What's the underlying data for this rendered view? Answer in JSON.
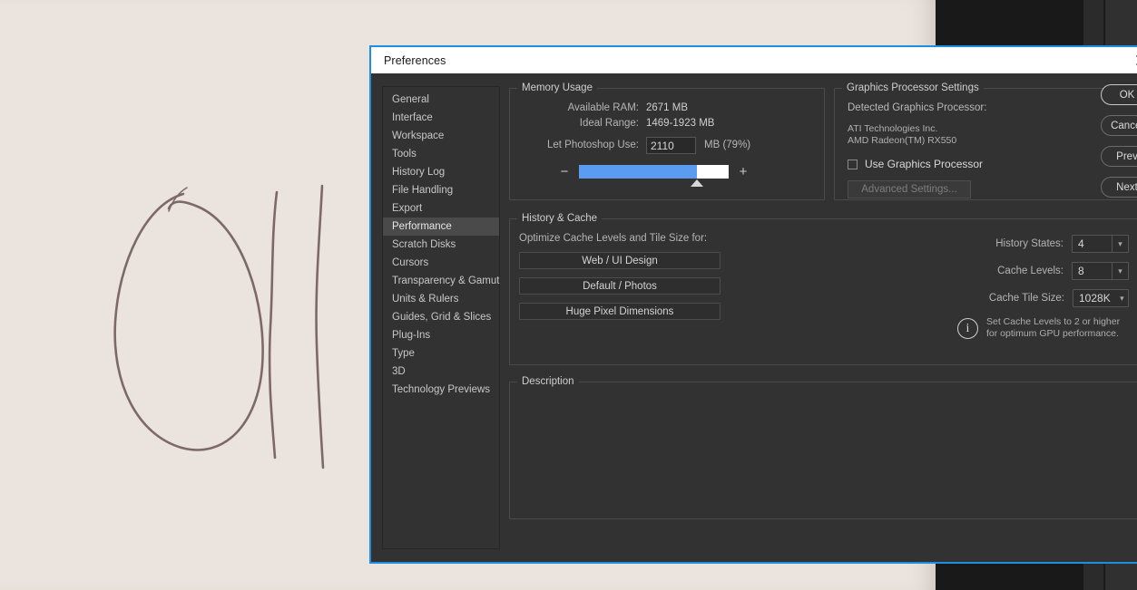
{
  "app": {
    "canvas_background": "#ebe4de",
    "stroke_color": "#7d6a66"
  },
  "dialog": {
    "title": "Preferences",
    "close_icon": "close-icon",
    "border_color": "#1a8fe3",
    "background": "#323232"
  },
  "sidebar": {
    "items": [
      {
        "label": "General",
        "selected": false
      },
      {
        "label": "Interface",
        "selected": false
      },
      {
        "label": "Workspace",
        "selected": false
      },
      {
        "label": "Tools",
        "selected": false
      },
      {
        "label": "History Log",
        "selected": false
      },
      {
        "label": "File Handling",
        "selected": false
      },
      {
        "label": "Export",
        "selected": false
      },
      {
        "label": "Performance",
        "selected": true
      },
      {
        "label": "Scratch Disks",
        "selected": false
      },
      {
        "label": "Cursors",
        "selected": false
      },
      {
        "label": "Transparency & Gamut",
        "selected": false
      },
      {
        "label": "Units & Rulers",
        "selected": false
      },
      {
        "label": "Guides, Grid & Slices",
        "selected": false
      },
      {
        "label": "Plug-Ins",
        "selected": false
      },
      {
        "label": "Type",
        "selected": false
      },
      {
        "label": "3D",
        "selected": false
      },
      {
        "label": "Technology Previews",
        "selected": false
      }
    ]
  },
  "memory_usage": {
    "legend": "Memory Usage",
    "available_ram_label": "Available RAM:",
    "available_ram_value": "2671 MB",
    "ideal_range_label": "Ideal Range:",
    "ideal_range_value": "1469-1923 MB",
    "let_photoshop_use_label": "Let Photoshop Use:",
    "let_photoshop_use_value": "2110",
    "units_label": "MB (79%)",
    "slider_percent": 79,
    "slider_minus": "−",
    "slider_plus": "+",
    "slider_fill_color": "#5b9bf0"
  },
  "graphics_processor": {
    "legend": "Graphics Processor Settings",
    "detected_label": "Detected Graphics Processor:",
    "vendor": "ATI Technologies Inc.",
    "model": "AMD Radeon(TM) RX550",
    "use_gpu_label": "Use Graphics Processor",
    "use_gpu_checked": false,
    "advanced_settings_label": "Advanced Settings...",
    "advanced_settings_enabled": false
  },
  "history_cache": {
    "legend": "History & Cache",
    "optimize_label": "Optimize Cache Levels and Tile Size for:",
    "presets": [
      {
        "label": "Web / UI Design"
      },
      {
        "label": "Default / Photos"
      },
      {
        "label": "Huge Pixel Dimensions"
      }
    ],
    "fields": [
      {
        "label": "History States:",
        "value": "4",
        "arrow": "chevron-down-icon"
      },
      {
        "label": "Cache Levels:",
        "value": "8",
        "arrow": "chevron-down-icon"
      },
      {
        "label": "Cache Tile Size:",
        "value": "1028K",
        "arrow": "chevron-down-icon"
      }
    ],
    "hint_icon": "info-icon",
    "hint_text": "Set Cache Levels to 2 or higher for optimum GPU performance."
  },
  "description": {
    "legend": "Description",
    "body": ""
  },
  "buttons": [
    {
      "label": "OK",
      "primary": true
    },
    {
      "label": "Cancel",
      "primary": false
    },
    {
      "label": "Prev",
      "primary": false
    },
    {
      "label": "Next",
      "primary": false
    }
  ]
}
